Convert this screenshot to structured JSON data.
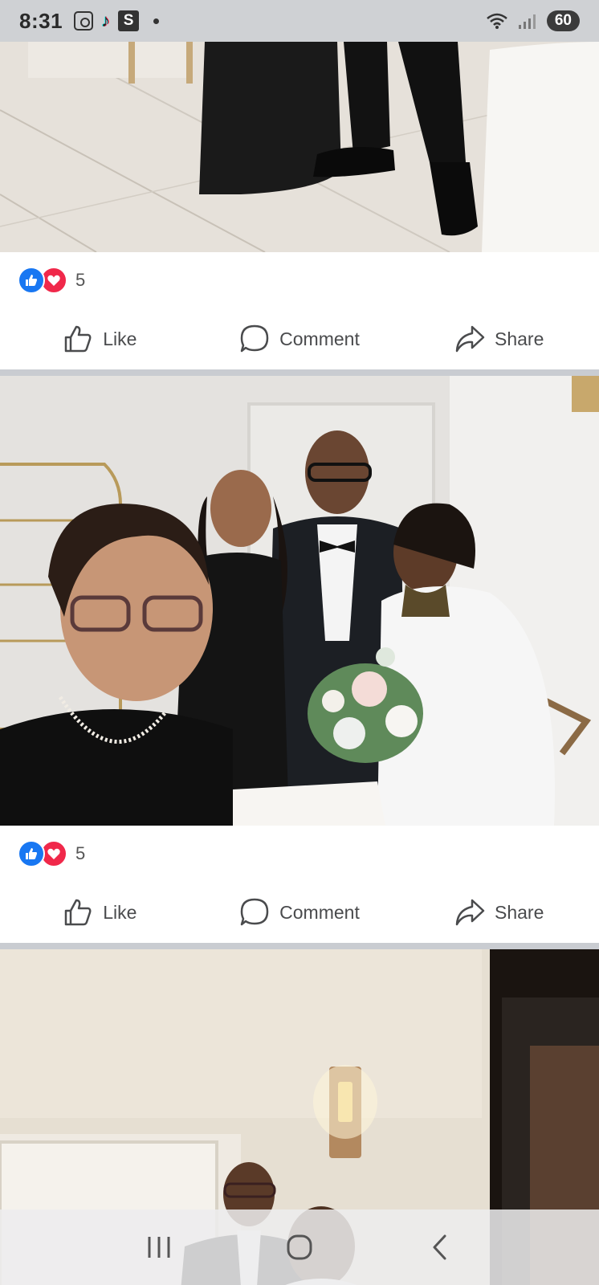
{
  "status_bar": {
    "time": "8:31",
    "battery": "60",
    "icons": [
      "screenshot-icon",
      "tiktok-icon",
      "s-app-icon",
      "notification-dot-icon",
      "wifi-icon",
      "signal-icon",
      "battery-icon"
    ]
  },
  "posts": [
    {
      "reaction_count": "5",
      "actions": {
        "like": "Like",
        "comment": "Comment",
        "share": "Share"
      }
    },
    {
      "reaction_count": "5",
      "actions": {
        "like": "Like",
        "comment": "Comment",
        "share": "Share"
      }
    }
  ],
  "colors": {
    "like_blue": "#1877f2",
    "love_red": "#f0284a",
    "action_text": "#4a4b4d",
    "separator": "#c9ccd1"
  },
  "nav_bar": {
    "buttons": [
      "recent-apps-icon",
      "home-icon",
      "back-icon"
    ]
  }
}
